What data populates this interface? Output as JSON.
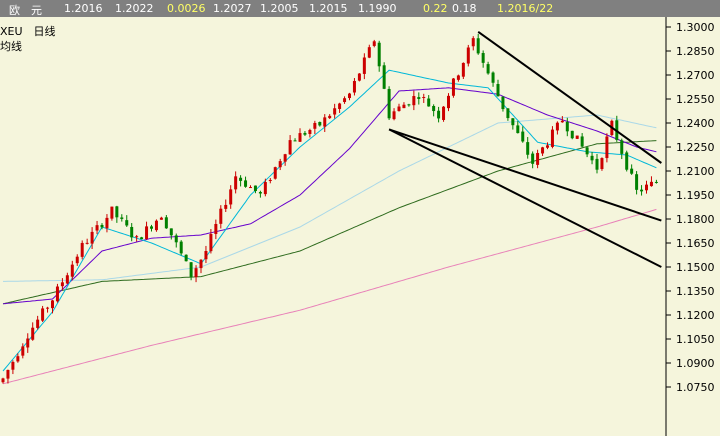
{
  "quote_bar": {
    "currency": "欧　元",
    "open": "1.2016",
    "high": "1.2022",
    "change": "0.0026",
    "low": "1.2027",
    "v1": "1.2005",
    "v2": "1.2015",
    "v3": "1.1990",
    "pct": "0.22",
    "amp": "0.18",
    "date": "1.2016/22"
  },
  "chart_labels": {
    "symbol_period": "XEU　日线",
    "ma_label": "均线"
  },
  "colors": {
    "background": "#f5f5dc",
    "up_candle": "#cc0000",
    "down_candle": "#008000",
    "ma_fast": "#00b8d8",
    "ma_mid": "#6600cc",
    "ma_slow_light": "#aad8e8",
    "ma_slow": "#2e6b1e",
    "ma_long": "#e880b8",
    "trend_line": "#000000"
  },
  "chart_data": {
    "type": "candlestick",
    "yticks": [
      "1.3000",
      "1.2850",
      "1.2700",
      "1.2550",
      "1.2400",
      "1.2250",
      "1.2100",
      "1.1950",
      "1.1800",
      "1.1650",
      "1.1500",
      "1.1350",
      "1.1200",
      "1.1050",
      "1.0900",
      "1.0750"
    ],
    "ylim": [
      1.0675,
      1.3085
    ],
    "n_bars": 133,
    "anchors": [
      [
        0,
        1.08
      ],
      [
        5,
        1.108
      ],
      [
        10,
        1.13
      ],
      [
        16,
        1.163
      ],
      [
        22,
        1.185
      ],
      [
        27,
        1.167
      ],
      [
        32,
        1.183
      ],
      [
        38,
        1.145
      ],
      [
        41,
        1.16
      ],
      [
        47,
        1.207
      ],
      [
        52,
        1.195
      ],
      [
        58,
        1.229
      ],
      [
        64,
        1.239
      ],
      [
        70,
        1.258
      ],
      [
        75,
        1.292
      ],
      [
        78,
        1.245
      ],
      [
        84,
        1.258
      ],
      [
        88,
        1.245
      ],
      [
        95,
        1.292
      ],
      [
        101,
        1.25
      ],
      [
        107,
        1.215
      ],
      [
        113,
        1.242
      ],
      [
        120,
        1.212
      ],
      [
        123,
        1.239
      ],
      [
        128,
        1.197
      ],
      [
        132,
        1.203
      ]
    ],
    "ma_fast": [
      [
        0,
        1.085
      ],
      [
        10,
        1.122
      ],
      [
        20,
        1.175
      ],
      [
        30,
        1.165
      ],
      [
        40,
        1.152
      ],
      [
        50,
        1.195
      ],
      [
        60,
        1.225
      ],
      [
        70,
        1.25
      ],
      [
        78,
        1.273
      ],
      [
        90,
        1.265
      ],
      [
        98,
        1.262
      ],
      [
        108,
        1.228
      ],
      [
        118,
        1.222
      ],
      [
        126,
        1.22
      ],
      [
        132,
        1.212
      ]
    ],
    "ma_mid": [
      [
        0,
        1.127
      ],
      [
        10,
        1.13
      ],
      [
        20,
        1.16
      ],
      [
        30,
        1.168
      ],
      [
        40,
        1.17
      ],
      [
        50,
        1.177
      ],
      [
        60,
        1.195
      ],
      [
        70,
        1.224
      ],
      [
        80,
        1.26
      ],
      [
        90,
        1.262
      ],
      [
        100,
        1.258
      ],
      [
        110,
        1.245
      ],
      [
        120,
        1.235
      ],
      [
        128,
        1.225
      ],
      [
        132,
        1.222
      ]
    ],
    "ma_slow_light": [
      [
        0,
        1.141
      ],
      [
        20,
        1.142
      ],
      [
        40,
        1.15
      ],
      [
        60,
        1.175
      ],
      [
        80,
        1.21
      ],
      [
        100,
        1.24
      ],
      [
        120,
        1.245
      ],
      [
        132,
        1.237
      ]
    ],
    "ma_slow": [
      [
        0,
        1.127
      ],
      [
        20,
        1.141
      ],
      [
        40,
        1.144
      ],
      [
        60,
        1.16
      ],
      [
        80,
        1.187
      ],
      [
        100,
        1.21
      ],
      [
        120,
        1.227
      ],
      [
        132,
        1.229
      ]
    ],
    "ma_long": [
      [
        0,
        1.077
      ],
      [
        30,
        1.101
      ],
      [
        60,
        1.123
      ],
      [
        90,
        1.15
      ],
      [
        120,
        1.175
      ],
      [
        132,
        1.186
      ]
    ],
    "trend_lines": [
      [
        [
          96,
          1.297
        ],
        [
          133,
          1.215
        ]
      ],
      [
        [
          78,
          1.236
        ],
        [
          133,
          1.15
        ]
      ],
      [
        [
          78,
          1.236
        ],
        [
          133,
          1.179
        ]
      ]
    ]
  }
}
